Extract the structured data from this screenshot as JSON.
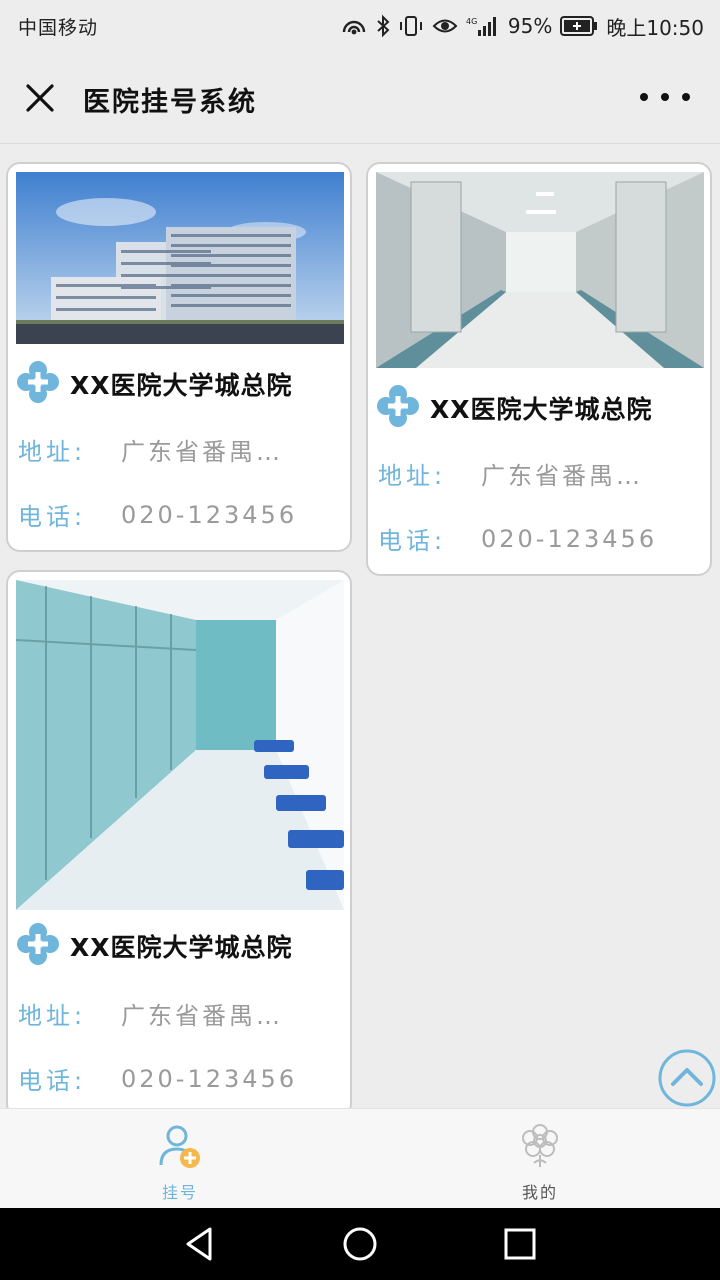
{
  "status_bar": {
    "carrier": "中国移动",
    "network": "4G",
    "battery": "95%",
    "time": "晚上10:50"
  },
  "nav": {
    "title": "医院挂号系统"
  },
  "hospitals": [
    {
      "name": "XX医院大学城总院",
      "address_label": "地址:",
      "address": "广东省番禺…",
      "phone_label": "电话:",
      "phone": "020-123456",
      "image": "building"
    },
    {
      "name": "XX医院大学城总院",
      "address_label": "地址:",
      "address": "广东省番禺…",
      "phone_label": "电话:",
      "phone": "020-123456",
      "image": "corridor"
    },
    {
      "name": "XX医院大学城总院",
      "address_label": "地址:",
      "address": "广东省番禺…",
      "phone_label": "电话:",
      "phone": "020-123456",
      "image": "waiting-area"
    }
  ],
  "tab_bar": {
    "tabs": [
      {
        "label": "挂号",
        "icon": "register-user-icon",
        "active": true
      },
      {
        "label": "我的",
        "icon": "profile-flower-icon",
        "active": false
      }
    ]
  },
  "colors": {
    "accent": "#6fb5dc",
    "muted_text": "#9a9a9a",
    "background": "#ededed"
  }
}
